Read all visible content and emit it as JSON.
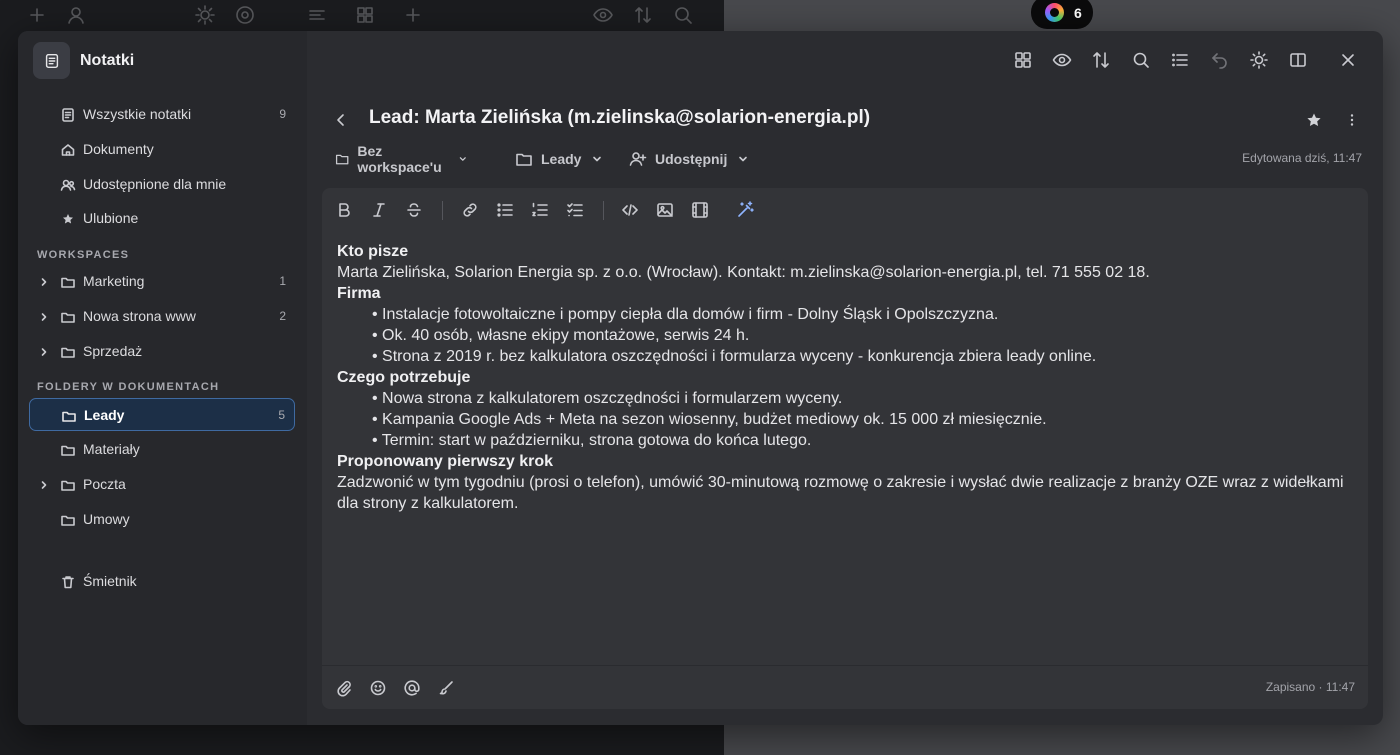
{
  "window": {
    "title": "Notatki",
    "badge_count": "6"
  },
  "sidebar": {
    "top_items": [
      {
        "label": "Wszystkie notatki",
        "count": "9"
      },
      {
        "label": "Dokumenty",
        "count": ""
      },
      {
        "label": "Udostępnione dla mnie",
        "count": ""
      },
      {
        "label": "Ulubione",
        "count": ""
      }
    ],
    "workspaces_title": "WORKSPACES",
    "workspaces": [
      {
        "label": "Marketing",
        "count": "1"
      },
      {
        "label": "Nowa strona www",
        "count": "2"
      },
      {
        "label": "Sprzedaż",
        "count": ""
      }
    ],
    "folders_title": "FOLDERY W DOKUMENTACH",
    "folders": [
      {
        "label": "Leady",
        "count": "5",
        "active": true
      },
      {
        "label": "Materiały",
        "count": ""
      },
      {
        "label": "Poczta",
        "count": ""
      },
      {
        "label": "Umowy",
        "count": ""
      }
    ],
    "trash_label": "Śmietnik"
  },
  "note": {
    "title": "Lead: Marta Zielińska (m.zielinska@solarion-energia.pl)",
    "workspace": "Bez workspace'u",
    "folder": "Leady",
    "share": "Udostępnij",
    "edited": "Edytowana dziś, 11:47",
    "saved": "Zapisano · 11:47"
  },
  "content": {
    "h1": "Kto pisze",
    "p1": "Marta Zielińska, Solarion Energia sp. z o.o. (Wrocław). Kontakt: m.zielinska@solarion-energia.pl, tel. 71 555 02 18.",
    "h2": "Firma",
    "firma": [
      "• Instalacje fotowoltaiczne i pompy ciepła dla domów i firm - Dolny Śląsk i Opolszczyzna.",
      "• Ok. 40 osób, własne ekipy montażowe, serwis 24 h.",
      "• Strona z 2019 r. bez kalkulatora oszczędności i formularza wyceny - konkurencja zbiera leady online."
    ],
    "h3": "Czego potrzebuje",
    "potrzeby": [
      "• Nowa strona z kalkulatorem oszczędności i formularzem wyceny.",
      "• Kampania Google Ads + Meta na sezon wiosenny, budżet mediowy ok. 15 000 zł miesięcznie.",
      "• Termin: start w październiku, strona gotowa do końca lutego."
    ],
    "h4": "Proponowany pierwszy krok",
    "p4": "Zadzwonić w tym tygodniu (prosi o telefon), umówić 30-minutową rozmowę o zakresie i wysłać dwie realizacje z branży OZE wraz z widełkami dla strony z kalkulatorem."
  },
  "colors": {
    "accent": "#3f6aa1",
    "modal_bg": "#2b2c30",
    "sidebar_bg": "#27282c",
    "editor_bg": "#333438"
  }
}
